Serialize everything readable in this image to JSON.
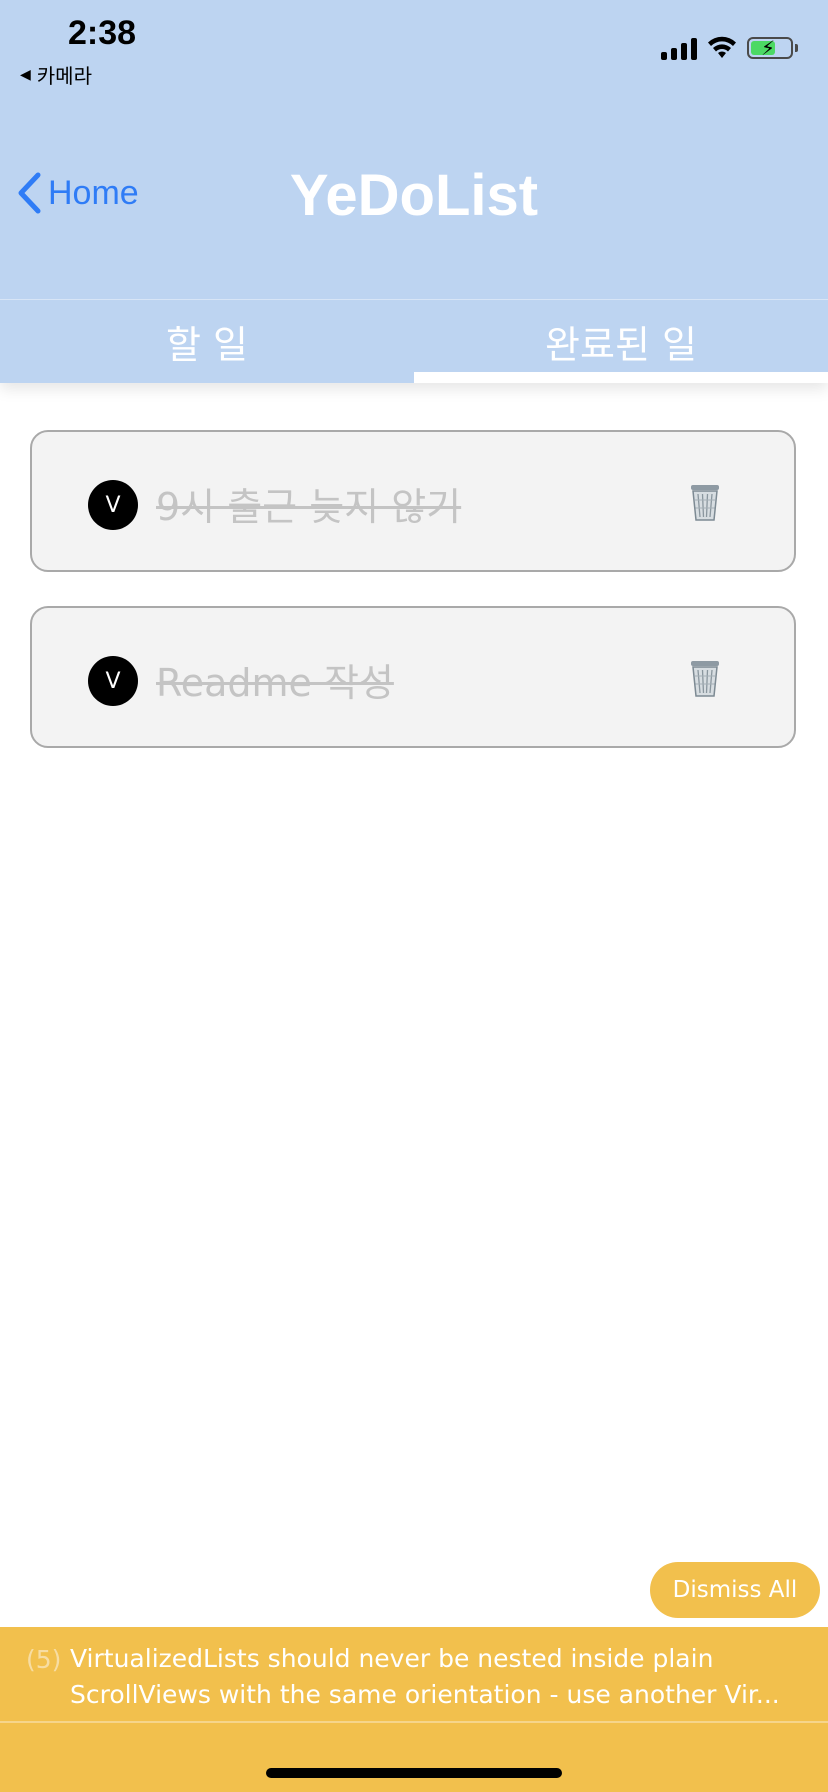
{
  "status_bar": {
    "time": "2:38",
    "back_app": "카메라",
    "back_arrow": "◀",
    "battery_color": "#4cd964"
  },
  "nav": {
    "back_label": "Home",
    "title": "YeDoList",
    "back_color": "#2f7cf6"
  },
  "tabs": [
    {
      "label": "할 일",
      "active": false
    },
    {
      "label": "완료된 일",
      "active": true
    }
  ],
  "todos": [
    {
      "check_label": "V",
      "text": "9시 출근 늦지 않기",
      "done": true,
      "icon": "trash-icon"
    },
    {
      "check_label": "V",
      "text": "Readme 작성",
      "done": true,
      "icon": "trash-icon"
    }
  ],
  "dismiss": {
    "label": "Dismiss All"
  },
  "warning": {
    "count": "(5)",
    "line1": "VirtualizedLists should never be nested inside plain",
    "line2": "ScrollViews with the same orientation - use another Vir...",
    "color": "#f2c04d"
  },
  "colors": {
    "header_bg": "#bdd4f1",
    "done_text": "#c4c4c4"
  }
}
